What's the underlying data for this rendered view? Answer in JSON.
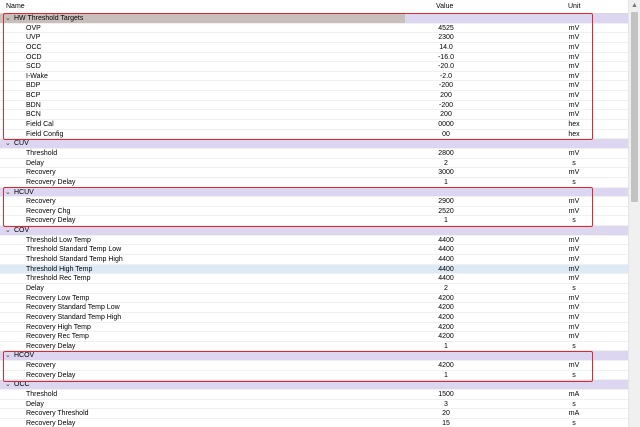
{
  "columns": {
    "name": "Name",
    "value": "Value",
    "unit": "Unit"
  },
  "colors": {
    "group_band": "#dcd6f0",
    "group_band_first": "#c8bfbd",
    "highlight": "#e2262b",
    "selected_row": "#ddeaf6"
  },
  "groups": [
    {
      "title": "HW Threshold Targets",
      "rows": [
        {
          "name": "OVP",
          "value": "4525",
          "unit": "mV"
        },
        {
          "name": "UVP",
          "value": "2300",
          "unit": "mV"
        },
        {
          "name": "OCC",
          "value": "14.0",
          "unit": "mV"
        },
        {
          "name": "OCD",
          "value": "-16.0",
          "unit": "mV"
        },
        {
          "name": "SCD",
          "value": "-20.0",
          "unit": "mV"
        },
        {
          "name": "I-Wake",
          "value": "-2.0",
          "unit": "mV"
        },
        {
          "name": "BDP",
          "value": "-200",
          "unit": "mV"
        },
        {
          "name": "BCP",
          "value": "200",
          "unit": "mV"
        },
        {
          "name": "BDN",
          "value": "-200",
          "unit": "mV"
        },
        {
          "name": "BCN",
          "value": "200",
          "unit": "mV"
        },
        {
          "name": "Field Cal",
          "value": "0000",
          "unit": "hex"
        },
        {
          "name": "Field Config",
          "value": "00",
          "unit": "hex"
        }
      ]
    },
    {
      "title": "CUV",
      "rows": [
        {
          "name": "Threshold",
          "value": "2800",
          "unit": "mV"
        },
        {
          "name": "Delay",
          "value": "2",
          "unit": "s"
        },
        {
          "name": "Recovery",
          "value": "3000",
          "unit": "mV"
        },
        {
          "name": "Recovery Delay",
          "value": "1",
          "unit": "s"
        }
      ]
    },
    {
      "title": "HCUV",
      "rows": [
        {
          "name": "Recovery",
          "value": "2900",
          "unit": "mV"
        },
        {
          "name": "Recovery Chg",
          "value": "2520",
          "unit": "mV"
        },
        {
          "name": "Recovery Delay",
          "value": "1",
          "unit": "s"
        }
      ]
    },
    {
      "title": "COV",
      "rows": [
        {
          "name": "Threshold Low Temp",
          "value": "4400",
          "unit": "mV"
        },
        {
          "name": "Threshold Standard Temp Low",
          "value": "4400",
          "unit": "mV"
        },
        {
          "name": "Threshold Standard Temp High",
          "value": "4400",
          "unit": "mV"
        },
        {
          "name": "Threshold High Temp",
          "value": "4400",
          "unit": "mV",
          "selected": true
        },
        {
          "name": "Threshold Rec Temp",
          "value": "4400",
          "unit": "mV"
        },
        {
          "name": "Delay",
          "value": "2",
          "unit": "s"
        },
        {
          "name": "Recovery Low Temp",
          "value": "4200",
          "unit": "mV"
        },
        {
          "name": "Recovery Standard Temp Low",
          "value": "4200",
          "unit": "mV"
        },
        {
          "name": "Recovery Standard Temp High",
          "value": "4200",
          "unit": "mV"
        },
        {
          "name": "Recovery High Temp",
          "value": "4200",
          "unit": "mV"
        },
        {
          "name": "Recovery Rec Temp",
          "value": "4200",
          "unit": "mV"
        },
        {
          "name": "Recovery Delay",
          "value": "1",
          "unit": "s"
        }
      ]
    },
    {
      "title": "HCOV",
      "rows": [
        {
          "name": "Recovery",
          "value": "4200",
          "unit": "mV"
        },
        {
          "name": "Recovery Delay",
          "value": "1",
          "unit": "s"
        }
      ]
    },
    {
      "title": "OCC",
      "rows": [
        {
          "name": "Threshold",
          "value": "1500",
          "unit": "mA"
        },
        {
          "name": "Delay",
          "value": "3",
          "unit": "s"
        },
        {
          "name": "Recovery Threshold",
          "value": "20",
          "unit": "mA"
        },
        {
          "name": "Recovery Delay",
          "value": "15",
          "unit": "s"
        }
      ]
    }
  ],
  "highlighted_groups": [
    "HW Threshold Targets",
    "HCUV",
    "HCOV"
  ]
}
